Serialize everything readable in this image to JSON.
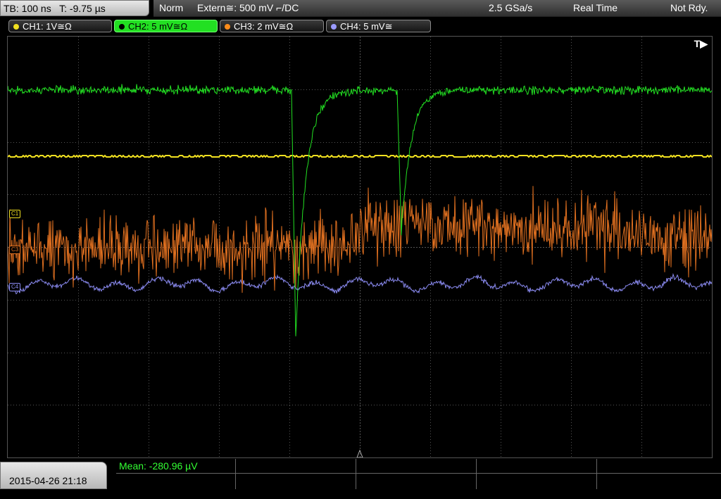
{
  "topbar": {
    "timebase": "TB: 100 ns",
    "trigger_time": "T: -9.75 µs",
    "mode": "Norm",
    "trigger_source": "Extern≅: 500 mV ⌐/DC",
    "sample_rate": "2.5 GSa/s",
    "acq_mode": "Real Time",
    "status": "Not Rdy."
  },
  "channels": [
    {
      "label": "CH1: 1V≅Ω",
      "color": "#f0e020",
      "active": false
    },
    {
      "label": "CH2: 5 mV≅Ω",
      "color": "#22e022",
      "active": true
    },
    {
      "label": "CH3: 2 mV≅Ω",
      "color": "#ff8c1a",
      "active": false
    },
    {
      "label": "CH4: 5 mV≅",
      "color": "#8888ff",
      "active": false
    }
  ],
  "display": {
    "trigger_marker": "T▶",
    "level_markers": [
      "C1",
      "C3",
      "C4"
    ]
  },
  "footer": {
    "datetime": "2015-04-26 21:18",
    "measurement": "Mean: -280.96 µV"
  },
  "colors": {
    "ch1": "#f0e020",
    "ch2": "#22e022",
    "ch3": "#e07020",
    "ch4": "#8a8af0",
    "grid": "#555555"
  }
}
